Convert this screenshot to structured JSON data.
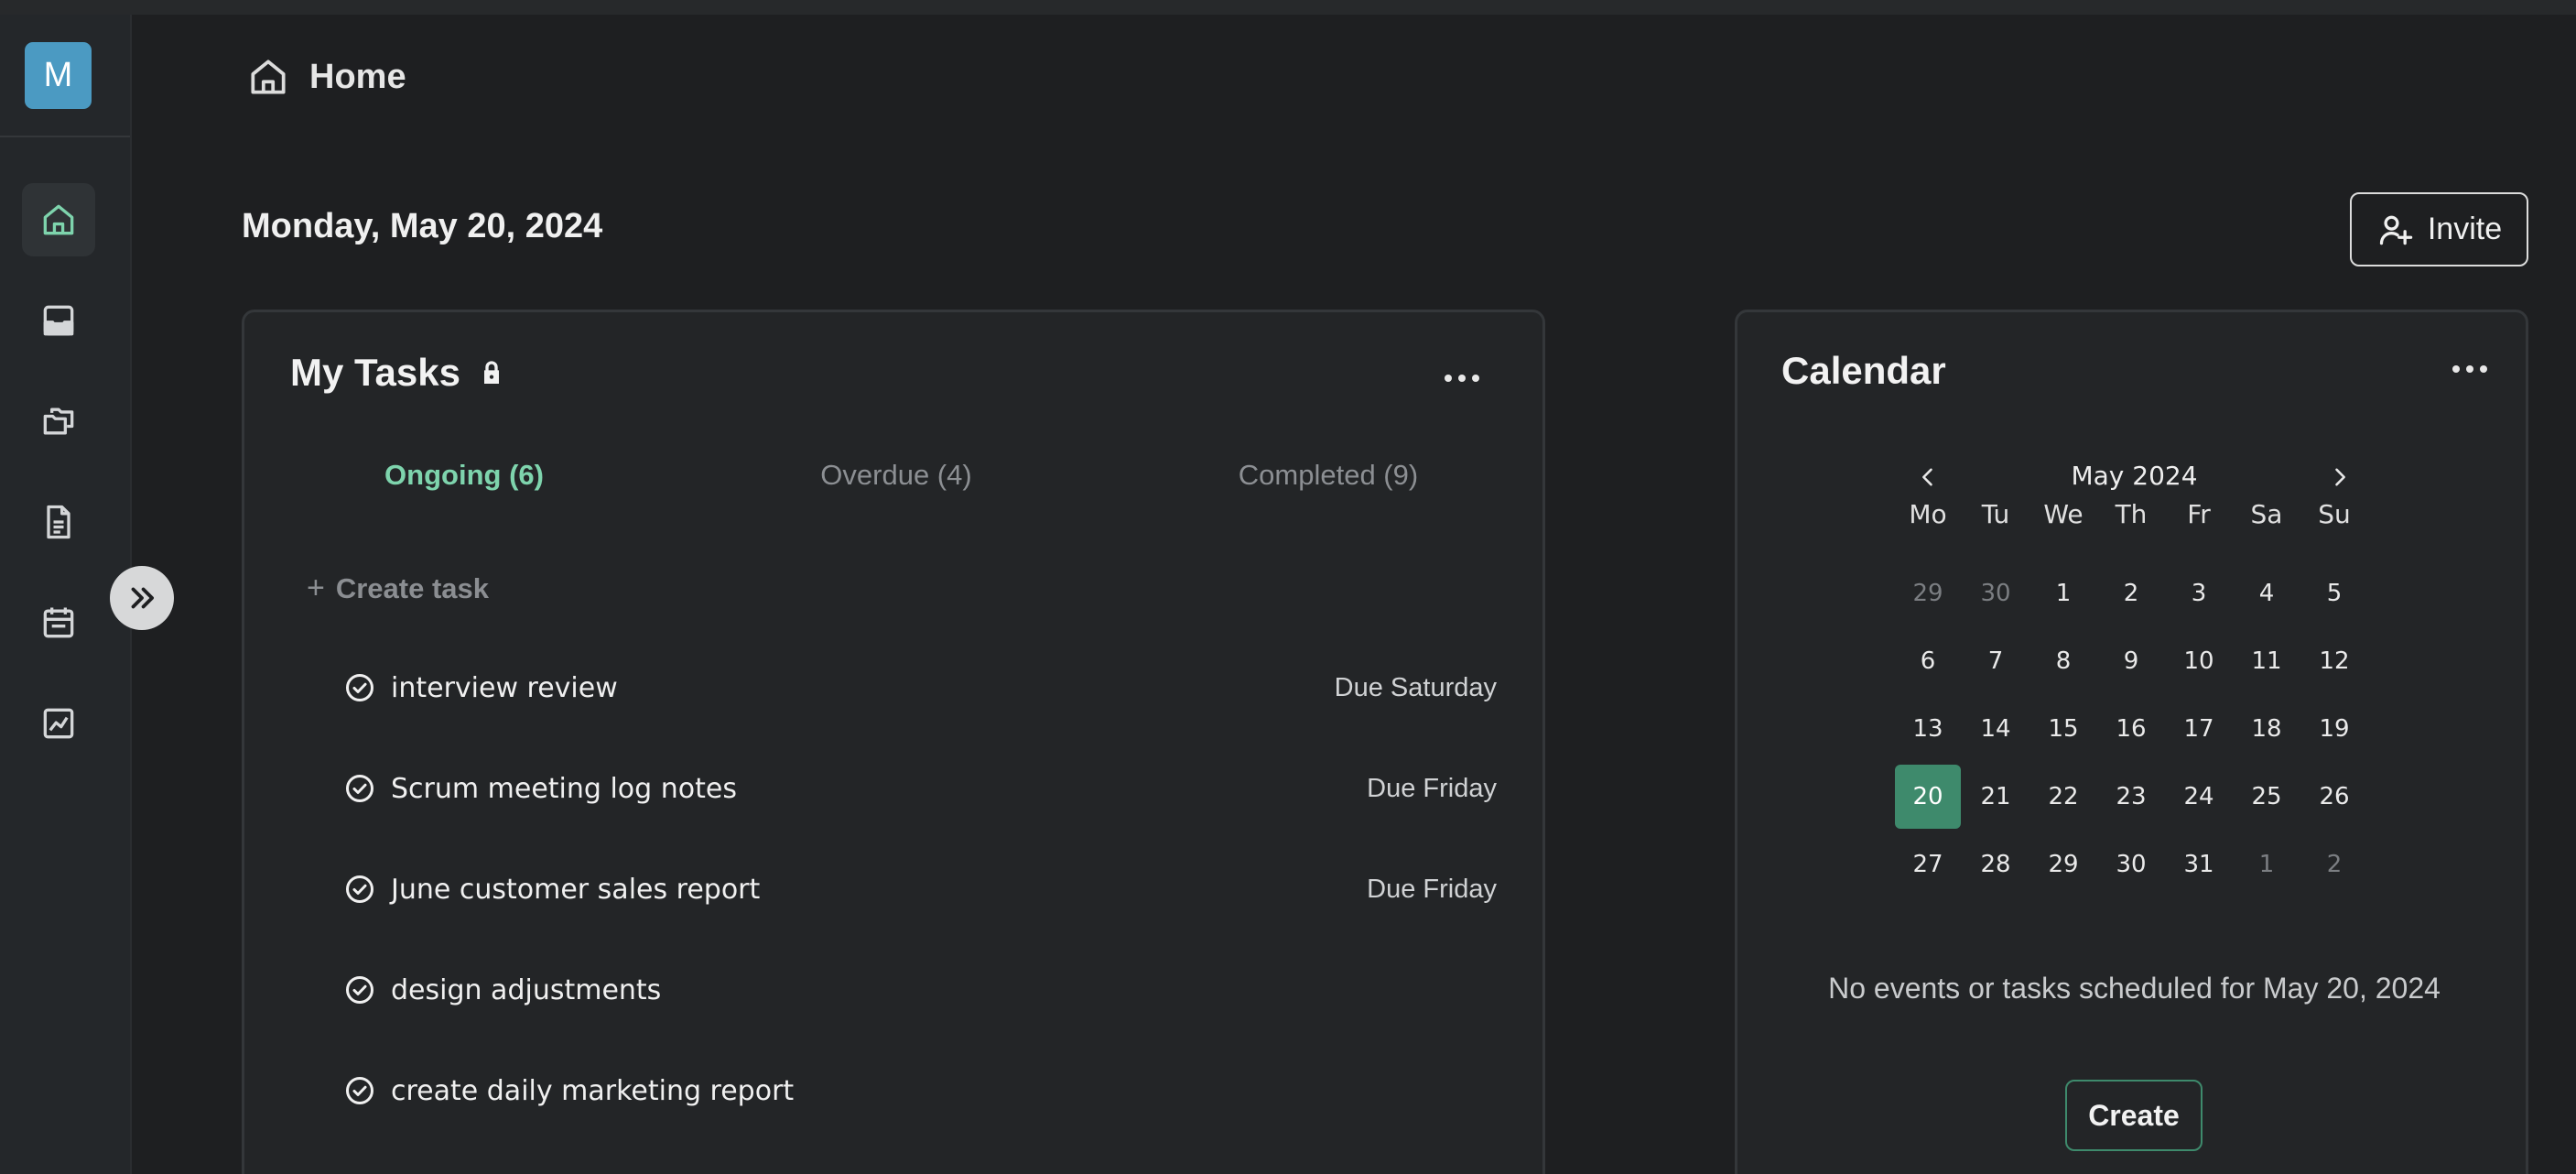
{
  "user": {
    "avatar_initial": "M",
    "avatar_color": "#4b9ac2"
  },
  "sidebar": {
    "items": [
      {
        "icon": "home-icon",
        "active": true
      },
      {
        "icon": "inbox-icon",
        "active": false
      },
      {
        "icon": "folders-icon",
        "active": false
      },
      {
        "icon": "document-icon",
        "active": false
      },
      {
        "icon": "calendar-icon",
        "active": false
      },
      {
        "icon": "chart-icon",
        "active": false
      }
    ],
    "expand_icon": "chevrons-right-icon"
  },
  "header": {
    "title": "Home",
    "icon": "home-icon"
  },
  "main": {
    "date": "Monday, May 20, 2024",
    "invite_label": "Invite"
  },
  "tasks_card": {
    "title": "My Tasks",
    "lock_icon": "lock-icon",
    "tabs": [
      {
        "label": "Ongoing (6)",
        "active": true
      },
      {
        "label": "Overdue (4)",
        "active": false
      },
      {
        "label": "Completed (9)",
        "active": false
      }
    ],
    "create_label": "Create task",
    "tasks": [
      {
        "name": "interview review",
        "due": "Due Saturday"
      },
      {
        "name": "Scrum meeting log notes",
        "due": "Due Friday"
      },
      {
        "name": "June customer sales report",
        "due": "Due Friday"
      },
      {
        "name": "design adjustments",
        "due": ""
      },
      {
        "name": "create daily marketing report",
        "due": ""
      }
    ]
  },
  "calendar_card": {
    "title": "Calendar",
    "month_label": "May 2024",
    "weekdays": [
      "Mo",
      "Tu",
      "We",
      "Th",
      "Fr",
      "Sa",
      "Su"
    ],
    "weeks": [
      [
        "29",
        "30",
        "1",
        "2",
        "3",
        "4",
        "5"
      ],
      [
        "6",
        "7",
        "8",
        "9",
        "10",
        "11",
        "12"
      ],
      [
        "13",
        "14",
        "15",
        "16",
        "17",
        "18",
        "19"
      ],
      [
        "20",
        "21",
        "22",
        "23",
        "24",
        "25",
        "26"
      ],
      [
        "27",
        "28",
        "29",
        "30",
        "31",
        "1",
        "2"
      ]
    ],
    "selected_day": "20",
    "no_events_text": "No events or tasks scheduled for May 20, 2024",
    "create_label": "Create"
  },
  "colors": {
    "accent": "#7ed4ad",
    "selected_day": "#3e8a6c",
    "background": "#1e1f21"
  }
}
